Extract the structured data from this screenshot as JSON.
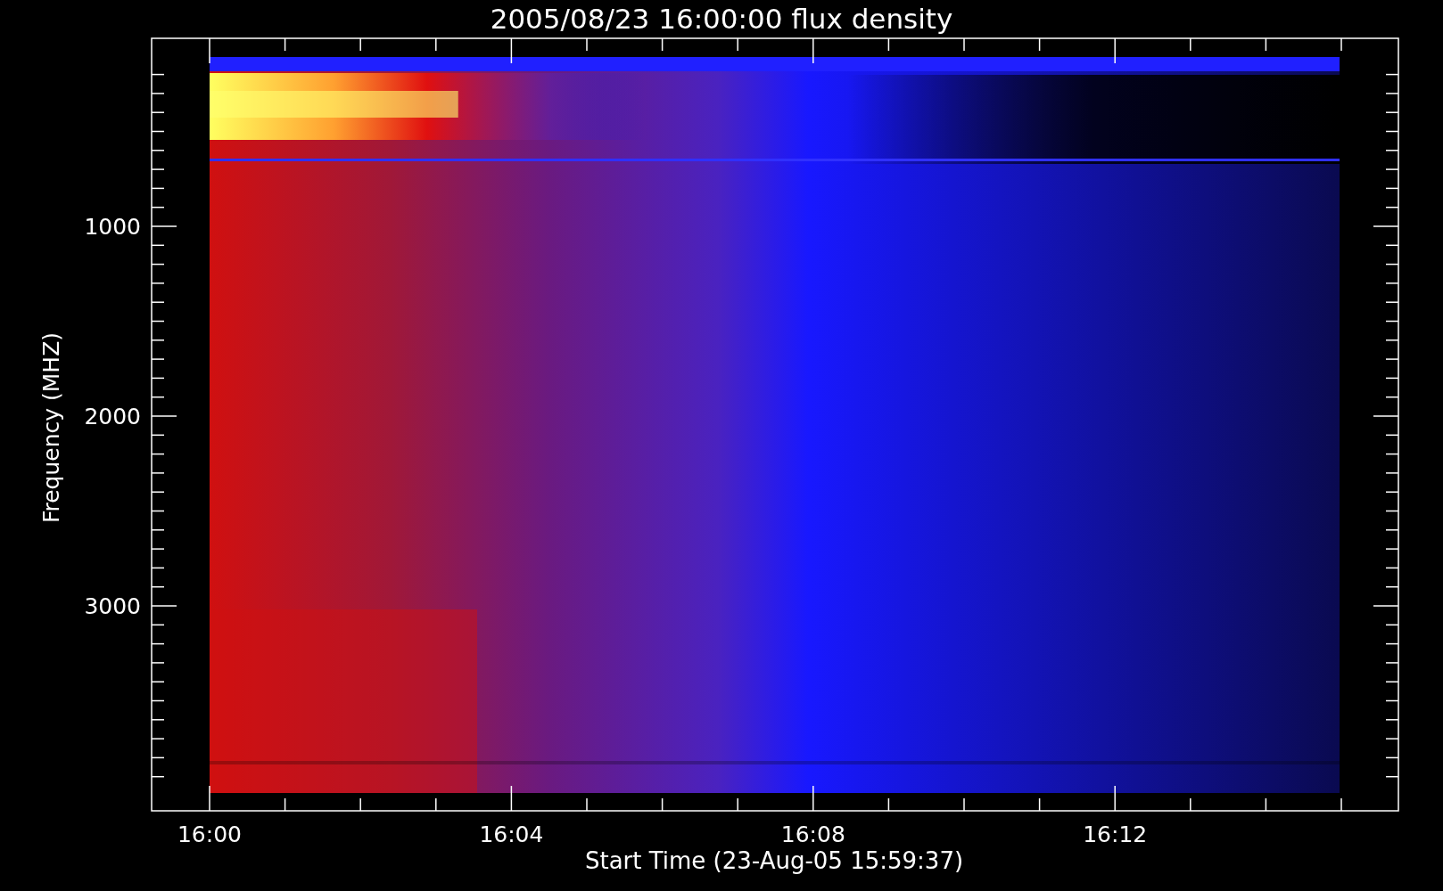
{
  "title": "2005/08/23 16:00:00 flux density",
  "plot": {
    "ylabel": "Frequency (MHZ)",
    "xlabel": "Start Time (23-Aug-05 15:59:37)",
    "y_tick_labels": [
      "1000",
      "2000",
      "3000"
    ],
    "x_tick_labels": [
      "16:00",
      "16:04",
      "16:08",
      "16:12"
    ]
  }
}
